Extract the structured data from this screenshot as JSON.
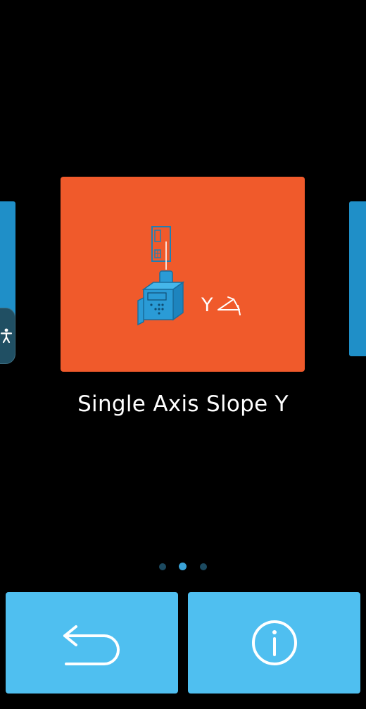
{
  "carousel": {
    "current_title": "Single Axis Slope Y",
    "card_axis_label": "Y",
    "page_count": 3,
    "active_page": 2,
    "card_color": "#f05a2b",
    "side_card_color": "#1f8fc8"
  },
  "accessibility": {
    "icon": "accessibility-person-icon"
  },
  "bottom_bar": {
    "back_icon": "back-arrow-icon",
    "info_icon": "info-circle-icon",
    "button_color": "#4fbff0"
  }
}
